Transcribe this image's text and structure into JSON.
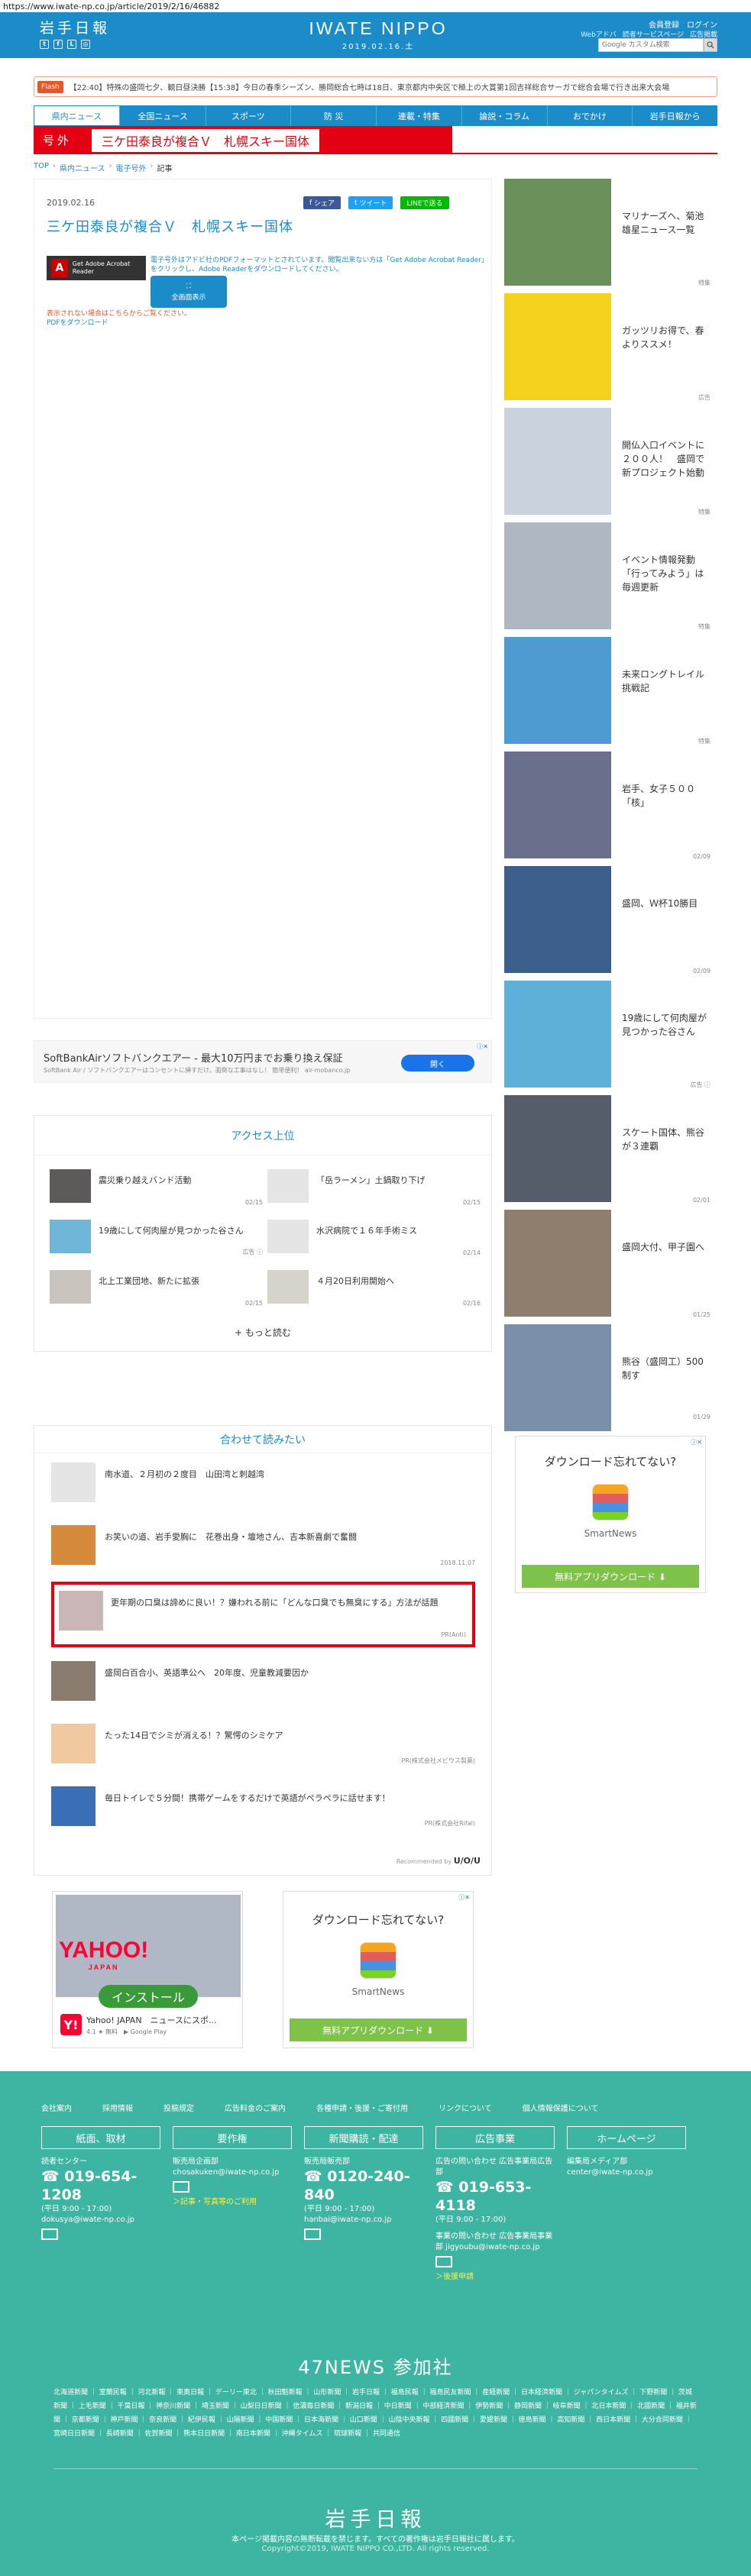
{
  "browser": {
    "url": "https://www.iwate-np.co.jp/article/2019/2/16/46882"
  },
  "header": {
    "logo_jp": "岩手日報",
    "brand": "IWATE NIPPO",
    "date": "2019.02.16.土",
    "register": "会員登録",
    "login": "ログイン",
    "web_ad": "Webアドバ",
    "reader": "読者サービスページ",
    "ad_info": "広告掲載",
    "search_placeholder": "Google カスタム検索"
  },
  "flash": {
    "tag": "Flash",
    "text": "【22:40】特殊の盛岡七夕、観日昼決勝【15:38】今日の春季シーズン、勝岡総合七時は18日、東京都内中央区で極上の大賞第1回吉祥総合サーガで総合会場で行き出来大会場"
  },
  "nav": {
    "items": [
      "県内ニュース",
      "全国ニュース",
      "スポーツ",
      "防 災",
      "連載・特集",
      "論説・コラム",
      "おでかけ",
      "岩手日報から"
    ]
  },
  "extra": {
    "label": "号外",
    "title": "三ケ田泰良が複合Ｖ　札幌スキー国体"
  },
  "breadcrumb": {
    "top": "TOP",
    "c1": "県内ニュース",
    "c2": "電子号外",
    "current": "記事"
  },
  "article": {
    "date": "2019.02.16",
    "share_fb": "シェア",
    "share_tw": "ツイート",
    "share_line": "LINEで送る",
    "title": "三ケ田泰良が複合Ｖ　札幌スキー国体",
    "acrobat": "Get Adobe Acrobat Reader",
    "pdf_note": "電子号外はアドビ社のPDFフォーマットとされています。閲覧出来ない方は「Get Adobe Acrobat Reader」をクリックし、Adobe Readerをダウンロードしてください。",
    "pdf_button": "全画面表示",
    "pdf_sub1": "表示されない場合はこちらからご覧ください。",
    "pdf_sub2": "PDFをダウンロード"
  },
  "adbanner": {
    "headline": "SoftBankAirソフトバンクエアー - 最大10万円までお乗り換え保証",
    "sub": "SoftBank Air / ソフトバンクエアーはコンセントに挿すだけ。面倒な工事はなし！ 簡単便利！ air-mobanco.jp",
    "button": "開く",
    "ad_mark": "ⓘ✕"
  },
  "access": {
    "title": "アクセス上位",
    "items": [
      {
        "title": "震災乗り越えバンド活動",
        "date": "02/15"
      },
      {
        "title": "「岳ラーメン」土鍋取り下げ",
        "date": "02/15"
      },
      {
        "title": "19歳にして何肉屋が見つかった谷さん",
        "date": "広告 ⓘ"
      },
      {
        "title": "水沢病院で１６年手術ミス",
        "date": "02/14"
      },
      {
        "title": "北上工業団地、新たに拡張",
        "date": "02/15"
      },
      {
        "title": "４月20日利用開始へ",
        "date": "02/16"
      }
    ],
    "more": "+ もっと読む"
  },
  "recommend": {
    "title": "合わせて読みたい",
    "items": [
      {
        "title": "南水道、２月初の２度目　山田湾と刺越湾",
        "date": ""
      },
      {
        "title": "お笑いの道、岩手愛胸に　花巻出身・壇地さん、吉本新喜劇で奮闘",
        "date": "2018.11.07"
      },
      {
        "title": "更年期の口臭は諦めに良い！？嫌われる前に「どんな口臭でも無臭にする」方法が話題",
        "date": "PR(Anti)"
      },
      {
        "title": "盛岡白百合小、英語準公へ　20年度、児童教減要因か",
        "date": ""
      },
      {
        "title": "たった14日でシミが消える！？驚愕のシミケア",
        "date": "PR(株式会社メビウス製薬)"
      },
      {
        "title": "毎日トイレで５分間！携帯ゲームをするだけで英語がペラペラに話せます！",
        "date": "PR(株式会社Rifal)"
      }
    ],
    "powered": "Recommended by",
    "powered_logo": "U/O/U"
  },
  "yahoo_ad": {
    "logo": "YAHOO!",
    "logo_sub": "JAPAN",
    "install": "インストール",
    "app": "Yahoo! JAPAN　ニュースにスポ...",
    "rating": "4.1 ★ 無料　▶ Google Play"
  },
  "smartnews": {
    "headline": "ダウンロード忘れてない?",
    "name": "SmartNews",
    "download": "無料アプリダウンロード ⬇",
    "ad_mark": "ⓘ✕"
  },
  "sidebar": {
    "items": [
      {
        "title": "マリナーズへ、菊池雄星ニュース一覧",
        "label": "特集",
        "color": "#6b8f5a"
      },
      {
        "title": "ガッツリお得で、春よりススメ！",
        "label": "広告",
        "color": "#f2d21c"
      },
      {
        "title": "開仏入口イベントに２００人！　盛岡で新プロジェクト始動",
        "label": "特集",
        "color": "#c9d3dd"
      },
      {
        "title": "イベント情報発動「行ってみよう」は毎週更新",
        "label": "特集",
        "color": "#aeb8c2"
      },
      {
        "title": "未来ロングトレイル挑戦記",
        "label": "特集",
        "color": "#4d9bd1"
      },
      {
        "title": "岩手、女子５００「核」",
        "label": "02/09",
        "color": "#6a6f8c"
      },
      {
        "title": "盛岡、Ｗ杯10勝目",
        "label": "02/09",
        "color": "#3b5f8a"
      },
      {
        "title": "19歳にして何肉屋が見つかった谷さん",
        "label": "広告 ⓘ",
        "color": "#5fb0d8"
      },
      {
        "title": "スケート国体、熊谷が３連覇",
        "label": "02/01",
        "color": "#555d6a"
      },
      {
        "title": "盛岡大付、甲子園へ",
        "label": "01/25",
        "color": "#8f7f6f"
      },
      {
        "title": "熊谷（盛岡工）500制す",
        "label": "01/29",
        "color": "#7a8fa8"
      }
    ]
  },
  "footer": {
    "links": [
      "会社案内",
      "採用情報",
      "投稿規定",
      "広告料金のご案内",
      "各種申請・後援・ご寄付用",
      "リンクについて",
      "個人情報保護について"
    ],
    "cols": [
      {
        "head": "紙面、取材",
        "l1": "読者センター",
        "tel": "019-654-1208",
        "hours": "(平日 9:00 - 17:00)",
        "mail": "dokusya@iwate-np.co.jp",
        "extra": ""
      },
      {
        "head": "要作権",
        "l1": "販売局企画部",
        "tel": "",
        "hours": "",
        "mail": "chosakuken@iwate-np.co.jp",
        "extra": "＞記事・写真等のご利用"
      },
      {
        "head": "新聞購読・配達",
        "l1": "販売局販売部",
        "tel": "0120-240-840",
        "hours": "(平日 9:00 - 17:00)",
        "mail": "hanbai@iwate-np.co.jp",
        "extra": ""
      },
      {
        "head": "広告事業",
        "l1": "広告の問い合わせ 広告事業局広告部",
        "tel": "019-653-4118",
        "hours": "(平日 9:00 - 17:00)",
        "mail": "事業の問い合わせ 広告事業局事業部 jigyoubu@iwate-np.co.jp",
        "extra": "＞後援申請"
      },
      {
        "head": "ホームページ",
        "l1": "編集局メディア部",
        "tel": "",
        "hours": "",
        "mail": "center@iwate-np.co.jp",
        "extra": ""
      }
    ],
    "news47": "47NEWS 参加社",
    "papers": "北海道新聞 ｜ 室蘭民報 ｜ 河北新報 ｜ 東奥日報 ｜ デーリー東北 ｜ 秋田魁新報 ｜ 山形新聞 ｜ 岩手日報 ｜ 福島民報 ｜ 福島民友新聞 ｜ 産経新聞 ｜ 日本経済新聞 ｜ ジャパンタイムズ ｜ 下野新聞 ｜ 茨城新聞 ｜ 上毛新聞 ｜ 千葉日報 ｜ 神奈川新聞 ｜ 埼玉新聞 ｜ 山梨日日新聞 ｜ 信濃毎日新聞 ｜ 新潟日報 ｜ 中日新聞 ｜ 中部経済新聞 ｜ 伊勢新聞 ｜ 静岡新聞 ｜ 岐阜新聞 ｜ 北日本新聞 ｜ 北國新聞 ｜ 福井新聞 ｜ 京都新聞 ｜ 神戸新聞 ｜ 奈良新聞 ｜ 紀伊民報 ｜ 山陽新聞 ｜ 中国新聞 ｜ 日本海新聞 ｜ 山口新聞 ｜ 山陰中央新報 ｜ 四國新聞 ｜ 愛媛新聞 ｜ 徳島新聞 ｜ 高知新聞 ｜ 西日本新聞 ｜ 大分合同新聞 ｜ 宮崎日日新聞 ｜ 長崎新聞 ｜ 佐賀新聞 ｜ 熊本日日新聞 ｜ 南日本新聞 ｜ 沖縄タイムス ｜ 琉球新報 ｜ 共同通信",
    "logo": "岩手日報",
    "note": "本ページ掲載内容の無断転載を禁じます。すべての著作権は岩手日報社に属します。",
    "copyright": "Copyright©2019, IWATE NIPPO CO.,LTD. All rights reserved."
  }
}
